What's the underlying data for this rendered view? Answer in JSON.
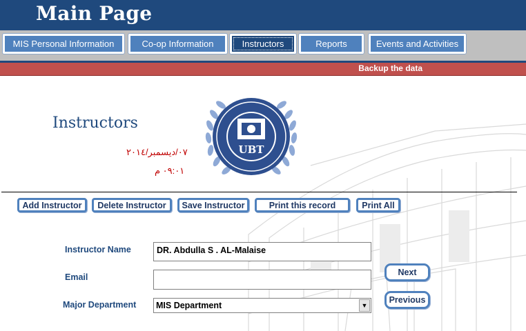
{
  "header": {
    "title": "Main Page"
  },
  "tabs": [
    {
      "label": "MIS Personal Information"
    },
    {
      "label": "Co-op Information"
    },
    {
      "label": "Instructors"
    },
    {
      "label": "Reports"
    },
    {
      "label": "Events and Activities"
    }
  ],
  "backup": {
    "label": "Backup the data"
  },
  "page": {
    "title": "Instructors",
    "date": "٠٧/ديسمبر/٢٠١٤",
    "time": "٠٩:٠١ م"
  },
  "logo": {
    "text": "UBT"
  },
  "actions": {
    "add": "Add Instructor",
    "delete": "Delete Instructor",
    "save": "Save Instructor",
    "print_record": "Print this record",
    "print_all": "Print All"
  },
  "form": {
    "name_label": "Instructor Name",
    "name_value": "DR. Abdulla S . AL-Malaise",
    "email_label": "Email",
    "email_value": "",
    "dept_label": "Major Department",
    "dept_value": "MIS Department"
  },
  "nav": {
    "next": "Next",
    "previous": "Previous"
  },
  "colors": {
    "header": "#1f497d",
    "tab": "#4f81bd",
    "tab_active": "#1f497d",
    "backup": "#c0504d",
    "date": "#c00000"
  }
}
